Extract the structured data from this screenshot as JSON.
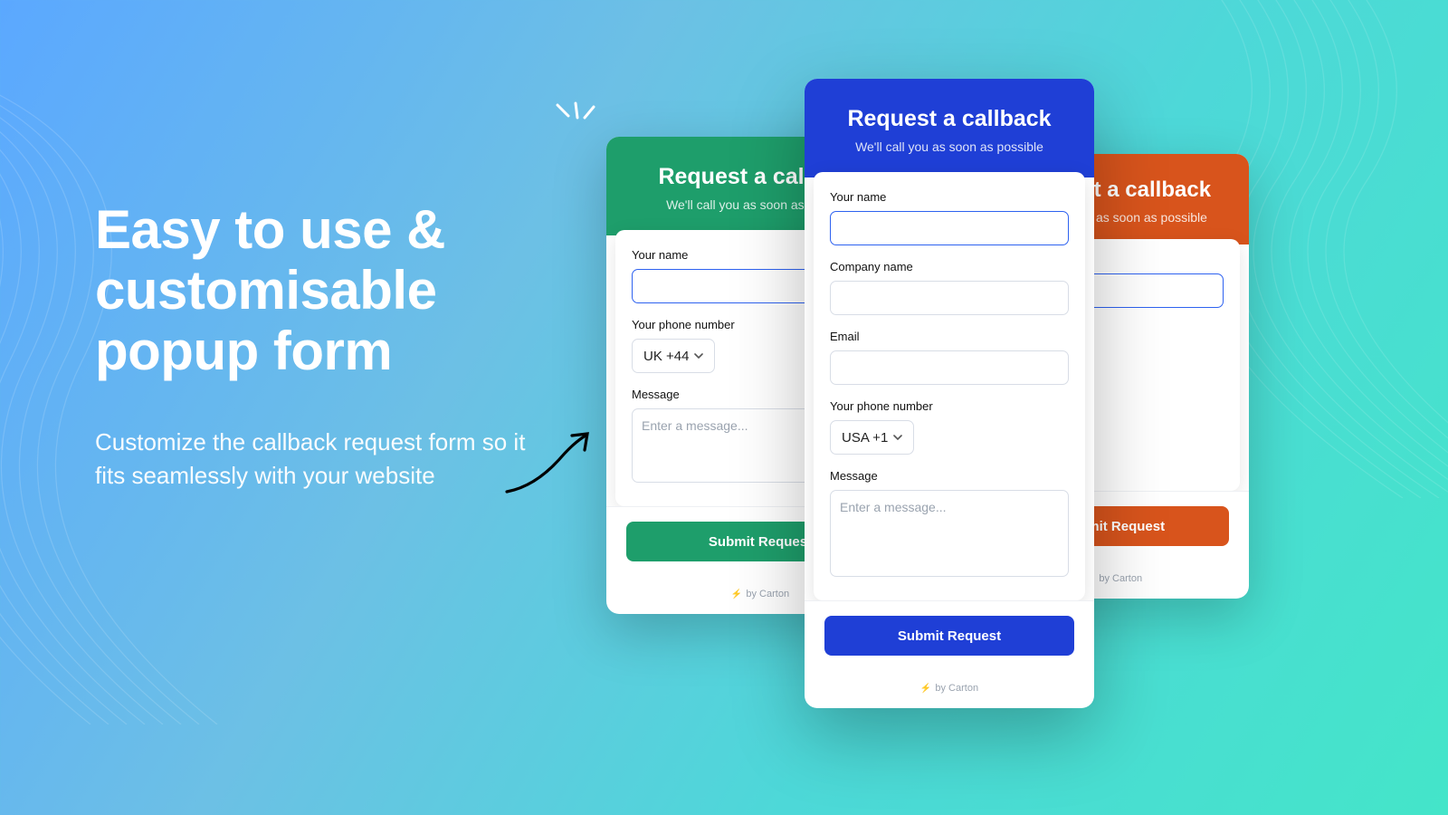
{
  "hero": {
    "headline": "Easy to use & customisable popup form",
    "subheadline": "Customize the callback request form so it fits seamlessly with your website"
  },
  "form_common": {
    "title": "Request a callback",
    "subtitle": "We'll call you as soon as possible",
    "labels": {
      "name": "Your name",
      "company": "Company name",
      "email": "Email",
      "phone": "Your phone number",
      "message": "Message"
    },
    "placeholders": {
      "message": "Enter a message..."
    },
    "submit": "Submit Request",
    "attribution": "by Carton"
  },
  "green_card": {
    "phone_select": "UK +44"
  },
  "blue_card": {
    "phone_select": "USA +1"
  },
  "orange_card": {
    "title_visible": "t a callback",
    "sub_visible": "as soon as possible",
    "submit_visible": "nit Request",
    "attrib_visible": "by Carton"
  },
  "colors": {
    "green": "#1e9e6b",
    "blue": "#1f3fd6",
    "orange": "#d8541c"
  }
}
